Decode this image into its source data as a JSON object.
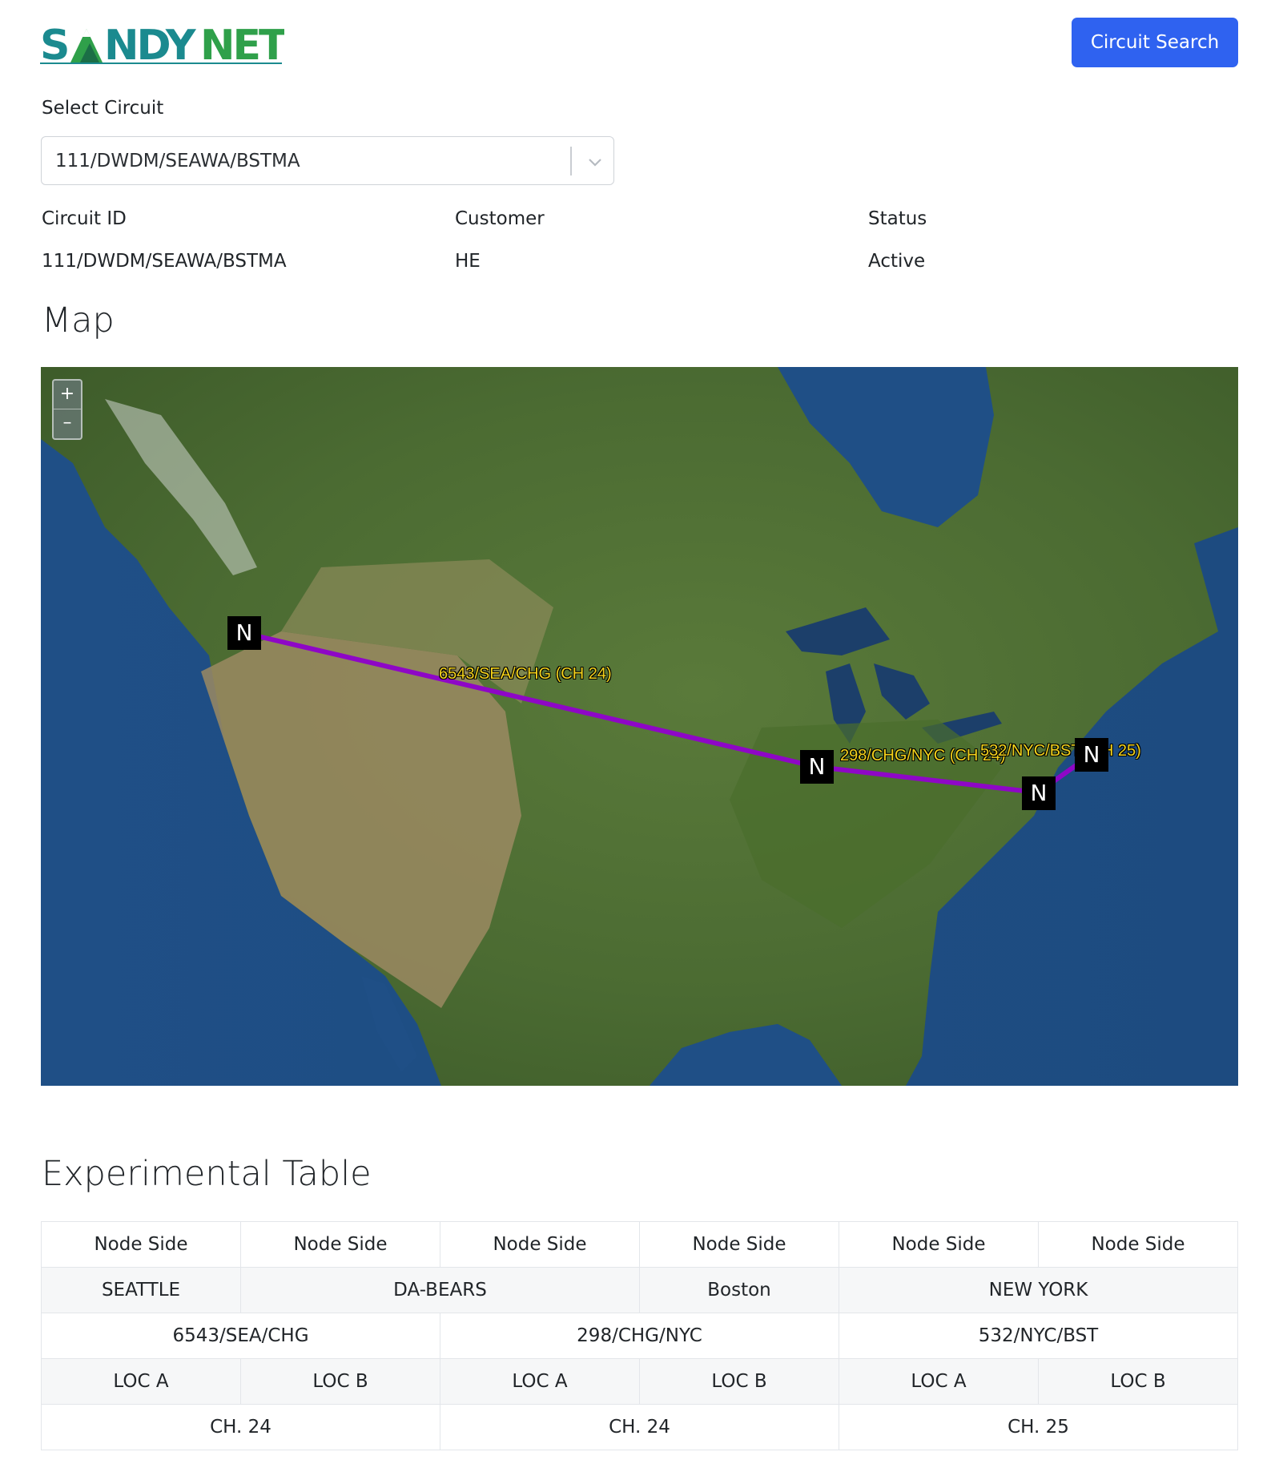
{
  "header": {
    "logo_text": "SANDYNET",
    "circuit_search_label": "Circuit Search"
  },
  "select": {
    "label": "Select Circuit",
    "value": "111/DWDM/SEAWA/BSTMA"
  },
  "info": {
    "circuit_id_label": "Circuit ID",
    "circuit_id_value": "111/DWDM/SEAWA/BSTMA",
    "customer_label": "Customer",
    "customer_value": "HE",
    "status_label": "Status",
    "status_value": "Active"
  },
  "map": {
    "title": "Map",
    "zoom_in": "+",
    "zoom_out": "–",
    "nodes": [
      "N",
      "N",
      "N",
      "N"
    ],
    "routes": [
      {
        "label": "6543/SEA/CHG (CH 24)"
      },
      {
        "label": "298/CHG/NYC (CH 24)"
      },
      {
        "label": "532/NYC/BST (CH 25)"
      }
    ],
    "route_color": "#8e07c6"
  },
  "table": {
    "title": "Experimental Table",
    "headers": [
      "Node Side",
      "Node Side",
      "Node Side",
      "Node Side",
      "Node Side",
      "Node Side"
    ],
    "sites": [
      "SEATTLE",
      "DA-BEARS",
      "Boston",
      "NEW YORK"
    ],
    "circuits": [
      "6543/SEA/CHG",
      "298/CHG/NYC",
      "532/NYC/BST"
    ],
    "locs": [
      "LOC A",
      "LOC B",
      "LOC A",
      "LOC B",
      "LOC A",
      "LOC B"
    ],
    "channels": [
      "CH. 24",
      "CH. 24",
      "CH. 25"
    ]
  },
  "colors": {
    "primary_button": "#2f62f0",
    "logo_teal": "#1b8a8f",
    "logo_green": "#2fa04a"
  }
}
